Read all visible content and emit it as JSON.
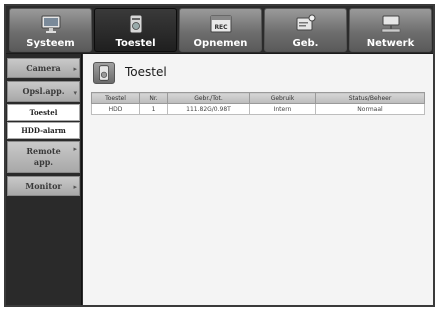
{
  "tabs": [
    {
      "label": "Systeem",
      "icon": "monitor-icon",
      "active": false
    },
    {
      "label": "Toestel",
      "icon": "device-icon",
      "active": true
    },
    {
      "label": "Opnemen",
      "icon": "rec-icon",
      "active": false
    },
    {
      "label": "Geb.",
      "icon": "event-icon",
      "active": false
    },
    {
      "label": "Netwerk",
      "icon": "network-icon",
      "active": false
    }
  ],
  "sidebar": {
    "items": [
      {
        "label": "Camera"
      },
      {
        "label": "Opsl.app."
      },
      {
        "label": "Toestel"
      },
      {
        "label": "HDD-alarm"
      },
      {
        "label": "Remote app."
      },
      {
        "label": "Monitor"
      }
    ]
  },
  "main": {
    "title": "Toestel",
    "table": {
      "headers": [
        "Toestel",
        "Nr.",
        "Gebr./Tot.",
        "Gebruik",
        "Status/Beheer"
      ],
      "rows": [
        [
          "HDD",
          "1",
          "111.82G/0.98T",
          "Intern",
          "Normaal"
        ]
      ]
    }
  },
  "colors": {
    "tab_active": "#1f1f1f",
    "tab_inactive": "#7a7a7a",
    "sidebar_bg": "#2a2a2a",
    "content_bg": "#f4f4f4"
  }
}
